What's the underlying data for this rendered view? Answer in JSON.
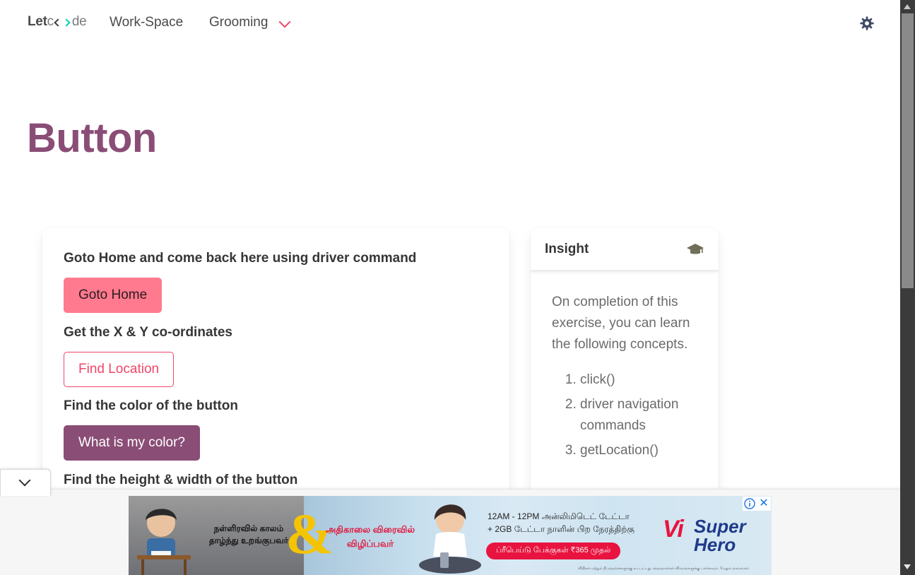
{
  "navbar": {
    "brand_prefix": "Let",
    "brand_suffix": "de",
    "links": [
      "Work-Space",
      "Grooming"
    ],
    "grooming_dropdown": "chevron-down-icon",
    "theme_icon": "gear-icon",
    "accent_color": "#f14668"
  },
  "page": {
    "title": "Button",
    "title_color": "#8a4d76"
  },
  "main_card": {
    "sections": [
      {
        "question": "Goto Home and come back here using driver command",
        "button_label": "Goto Home"
      },
      {
        "question": "Get the X & Y co-ordinates",
        "button_label": "Find Location"
      },
      {
        "question": "Find the color of the button",
        "button_label": "What is my color?"
      },
      {
        "question": "Find the height & width of the button"
      }
    ]
  },
  "insight": {
    "title": "Insight",
    "icon": "graduation-cap-icon",
    "intro": "On completion of this exercise, you can learn the following concepts.",
    "concepts": [
      "click()",
      "driver navigation commands",
      "getLocation()"
    ]
  },
  "ad": {
    "text_left": "நள்ளிரவில் காலம் தாழ்ந்து உறங்குபவர்",
    "ampersand": "&",
    "text_mid": "அதிகாலை விரைவில் விழிப்பவர்",
    "text_right_line1": "12AM - 12PM அன்லிமிடெட் டேட்டா",
    "text_right_line2": "+ 2GB டேட்டா நாளின் பிற நேரத்திற்கு",
    "pill": "ப்ரீபெய்டு பேக்குகள் ₹365 முதல்",
    "brand_vi": "Vi",
    "brand_hero": "Super Hero",
    "fine_print": "விதிகள் மற்றும் நிபந்தனைகளுக்கு உட்பட்டது. சந்தாதாரர்கள் விவரங்களுக்கு பார்க்கவும். மேலும் தகவல்கள்",
    "info_icon": "info-icon",
    "close_icon": "close-icon",
    "collapse_icon": "chevron-down-icon"
  }
}
